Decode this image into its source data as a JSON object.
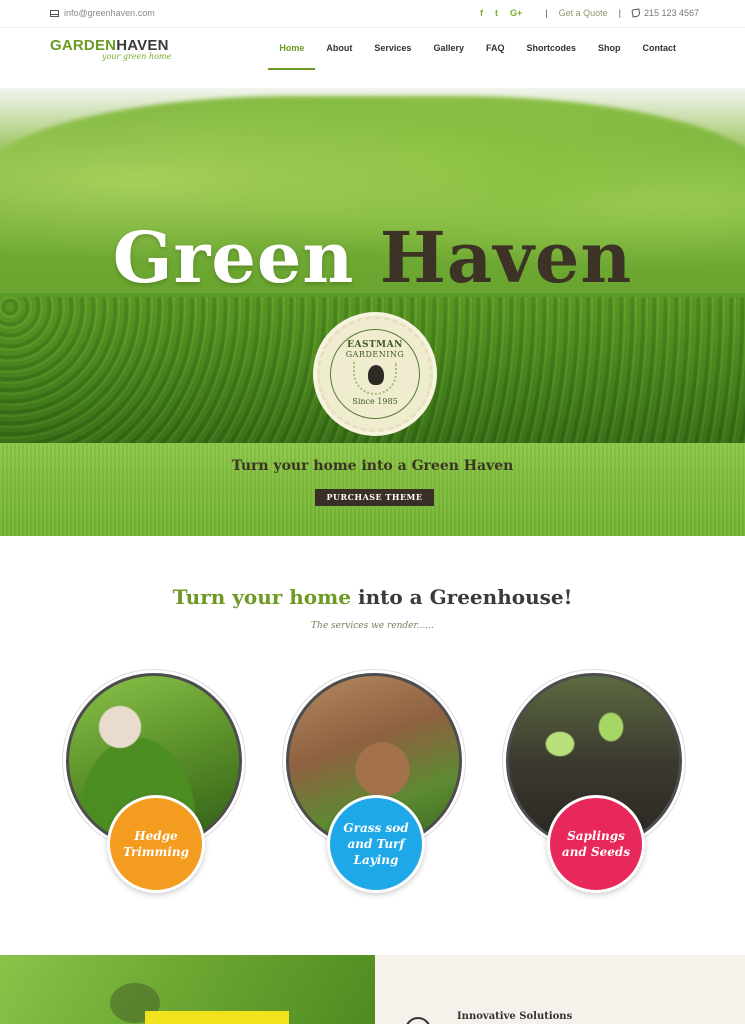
{
  "topbar": {
    "email": "info@greenhaven.com",
    "social": [
      "f",
      "t",
      "G+"
    ],
    "quote": "Get a Quote",
    "phone": "215 123 4567"
  },
  "logo": {
    "part1": "GARDEN",
    "part2": "HAVEN",
    "tagline": "your green home"
  },
  "nav": {
    "items": [
      {
        "label": "Home",
        "active": true
      },
      {
        "label": "About"
      },
      {
        "label": "Services"
      },
      {
        "label": "Gallery"
      },
      {
        "label": "FAQ"
      },
      {
        "label": "Shortcodes"
      },
      {
        "label": "Shop"
      },
      {
        "label": "Contact"
      }
    ]
  },
  "hero": {
    "title_1": "Green",
    "title_2": "Haven",
    "badge": {
      "line1": "EASTMAN",
      "line2": "GARDENING",
      "line3": "Since 1985"
    },
    "subtitle": "Turn your home into a Green Haven",
    "button": "PURCHASE THEME"
  },
  "services": {
    "heading_highlight": "Turn your home",
    "heading_rest": "into a Greenhouse!",
    "subtitle": "The services we render......",
    "items": [
      {
        "label": "Hedge Trimming",
        "color": "#f39c1f"
      },
      {
        "label": "Grass sod and Turf Laying",
        "color": "#1fa8e8"
      },
      {
        "label": "Saplings and Seeds",
        "color": "#e8275a"
      }
    ]
  },
  "bottom": {
    "title": "Innovative Solutions"
  },
  "colors": {
    "brand_green": "#6c9a23",
    "dark_brown": "#3a2f27"
  }
}
